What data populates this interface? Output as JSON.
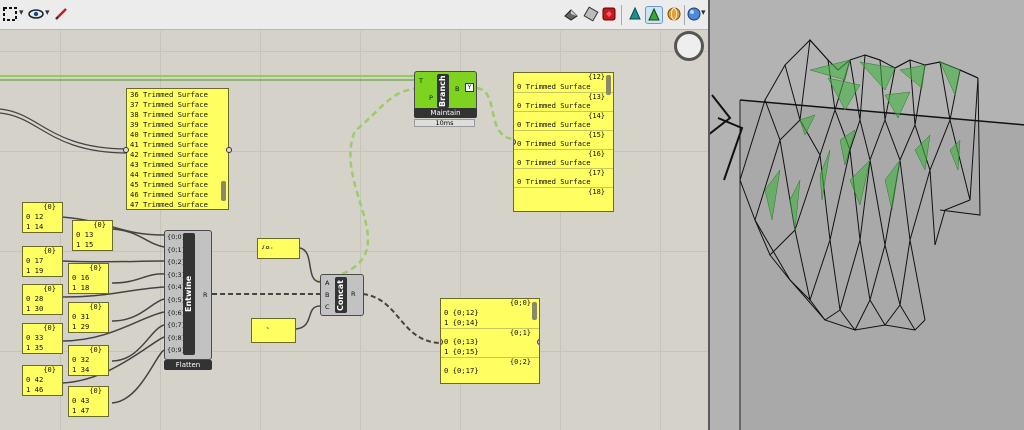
{
  "toolbar": {
    "icons": [
      "zoom-extents-icon",
      "eye-icon",
      "sketch-pen-icon",
      "preview-shaded-icon",
      "preview-wire-icon",
      "preview-off-icon",
      "bake-icon",
      "preview-selected-icon",
      "sphere-icon",
      "globe-icon"
    ]
  },
  "panels": {
    "surfaces": {
      "rows": [
        "36 Trimmed Surface",
        "37 Trimmed Surface",
        "38 Trimmed Surface",
        "39 Trimmed Surface",
        "40 Trimmed Surface",
        "41 Trimmed Surface",
        "42 Trimmed Surface",
        "43 Trimmed Surface",
        "44 Trimmed Surface",
        "45 Trimmed Surface",
        "46 Trimmed Surface",
        "47 Trimmed Surface"
      ]
    },
    "branch_out": {
      "groups": [
        {
          "header": "{12}",
          "row": "0 Trimmed Surface"
        },
        {
          "header": "{13}",
          "row": "0 Trimmed Surface"
        },
        {
          "header": "{14}",
          "row": "0 Trimmed Surface"
        },
        {
          "header": "{15}",
          "row": "0 Trimmed Surface"
        },
        {
          "header": "{16}",
          "row": "0 Trimmed Surface"
        },
        {
          "header": "{17}",
          "row": "0 Trimmed Surface"
        },
        {
          "header": "{18}",
          "row": ""
        }
      ]
    },
    "concat_a": {
      "text": "{0;"
    },
    "concat_c": {
      "text": "}"
    },
    "concat_out": {
      "groups": [
        {
          "header": "{0;0}",
          "rows": [
            "0 {0;12}",
            "1 {0;14}"
          ]
        },
        {
          "header": "{0;1}",
          "rows": [
            "0 {0;13}",
            "1 {0;15}"
          ]
        },
        {
          "header": "{0;2}",
          "rows": [
            "0 {0;17}"
          ]
        }
      ]
    },
    "pairs": [
      {
        "header": "{0}",
        "rows": [
          "0 12",
          "1 14"
        ]
      },
      {
        "header": "{0}",
        "rows": [
          "0 13",
          "1 15"
        ]
      },
      {
        "header": "{0}",
        "rows": [
          "0 17",
          "1 19"
        ]
      },
      {
        "header": "{0}",
        "rows": [
          "0 16",
          "1 18"
        ]
      },
      {
        "header": "{0}",
        "rows": [
          "0 28",
          "1 30"
        ]
      },
      {
        "header": "{0}",
        "rows": [
          "0 31",
          "1 29"
        ]
      },
      {
        "header": "{0}",
        "rows": [
          "0 33",
          "1 35"
        ]
      },
      {
        "header": "{0}",
        "rows": [
          "0 32",
          "1 34"
        ]
      },
      {
        "header": "{0}",
        "rows": [
          "0 42",
          "1 46"
        ]
      },
      {
        "header": "{0}",
        "rows": [
          "0 43",
          "1 47"
        ]
      }
    ]
  },
  "components": {
    "branch": {
      "name": "Branch",
      "in_t": "T",
      "in_p": "P",
      "out_b": "B",
      "caption": "Maintain",
      "timing": "10ms"
    },
    "entwine": {
      "name": "Entwine",
      "inputs": [
        "{0;0}",
        "{0;1}",
        "{0;2}",
        "{0;3}",
        "{0;4}",
        "{0;5}",
        "{0;6}",
        "{0;7}",
        "{0;8}",
        "{0;9}"
      ],
      "output": "R",
      "caption": "Flatten"
    },
    "concat": {
      "name": "Concat",
      "inputs": [
        "A",
        "B",
        "C"
      ],
      "output": "R"
    }
  },
  "colors": {
    "panel": "#ffff61",
    "branch_green": "#7ed321",
    "wire": "#3c3c3c",
    "wire_green": "#9ccc6a"
  }
}
